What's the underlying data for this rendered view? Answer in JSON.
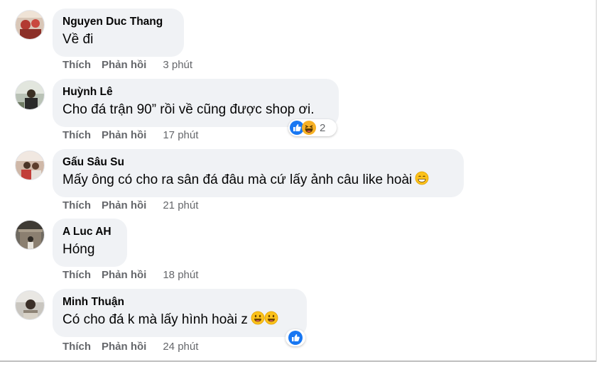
{
  "actions": {
    "like": "Thích",
    "reply": "Phản hồi"
  },
  "comments": [
    {
      "author": "Nguyen Duc Thang",
      "text": "Về đi",
      "time": "3 phút",
      "emojis": [],
      "reactions": null
    },
    {
      "author": "Huỳnh Lê",
      "text": "Cho đá trận 90” rồi về cũng được shop ơi.",
      "time": "17 phút",
      "emojis": [],
      "reactions": {
        "icons": [
          "like-icon",
          "haha-icon"
        ],
        "count": "2"
      }
    },
    {
      "author": "Gấu Sâu Su",
      "text": "Mấy ông có cho ra sân đá đâu mà cứ lấy ảnh câu like hoài",
      "time": "21 phút",
      "emojis": [
        "grin-emoji"
      ],
      "reactions": null
    },
    {
      "author": "A Luc AH",
      "text": "Hóng",
      "time": "18 phút",
      "emojis": [],
      "reactions": null
    },
    {
      "author": "Minh Thuận",
      "text": "Có cho đá k mà lấy hình hoài z",
      "time": "24 phút",
      "emojis": [
        "smile-emoji",
        "smile-emoji"
      ],
      "reactions": {
        "icons": [
          "like-icon"
        ],
        "count": ""
      }
    }
  ],
  "colors": {
    "bubble": "#f0f2f5",
    "meta": "#65676b",
    "like": "#1877f2",
    "haha": "#f7b125"
  }
}
